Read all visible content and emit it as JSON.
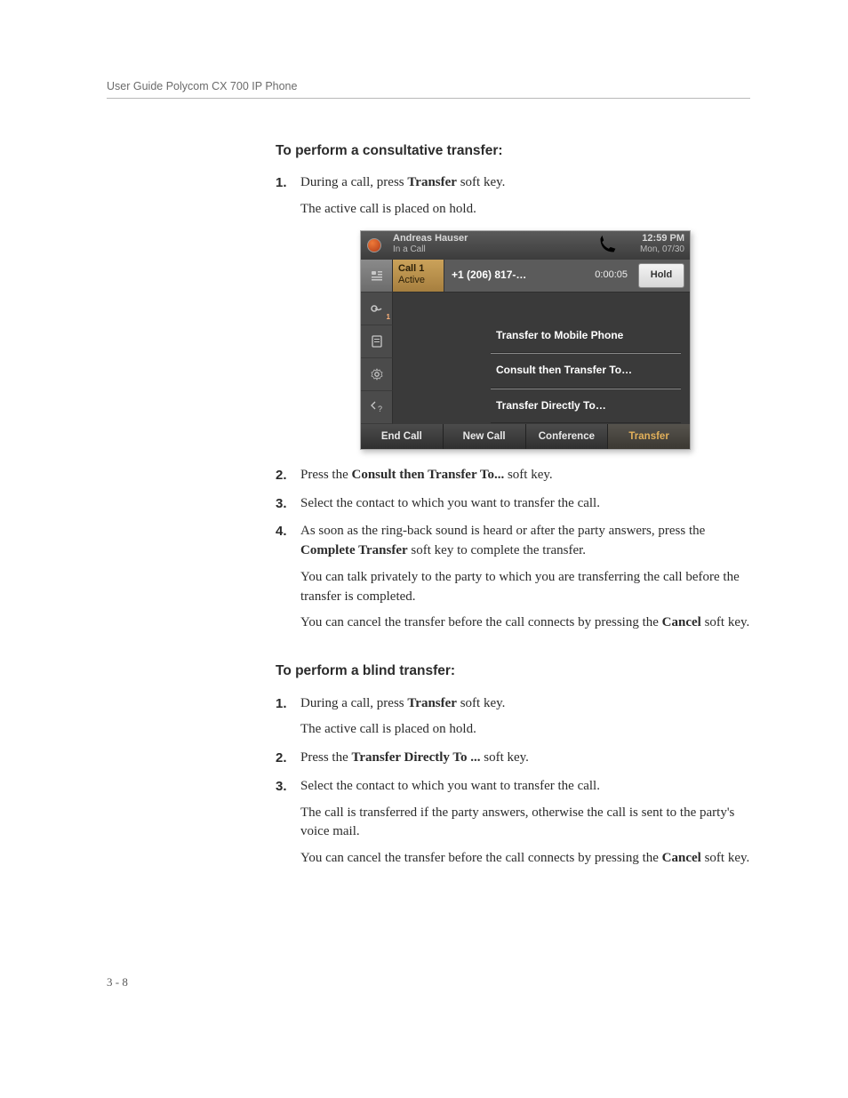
{
  "runhead": "User Guide Polycom CX 700 IP Phone",
  "section1": {
    "heading": "To perform a consultative transfer:",
    "steps": {
      "s1a": "During a call, press ",
      "s1_bold": "Transfer",
      "s1b": " soft key.",
      "s1_p": "The active call is placed on hold.",
      "s2a": "Press the ",
      "s2_bold": "Consult then Transfer To...",
      "s2b": " soft key.",
      "s3": "Select the contact to which you want to transfer the call.",
      "s4a": "As soon as the ring-back sound is heard or after the party answers, press the ",
      "s4_bold": "Complete Transfer",
      "s4b": " soft key to complete the transfer.",
      "s4_p1": "You can talk privately to the party to which you are transferring the call before the transfer is completed.",
      "s4_p2a": "You can cancel the transfer before the call connects by pressing the ",
      "s4_p2_bold": "Cancel",
      "s4_p2b": " soft key."
    }
  },
  "section2": {
    "heading": "To perform a blind transfer:",
    "steps": {
      "s1a": "During a call, press ",
      "s1_bold": "Transfer",
      "s1b": " soft key.",
      "s1_p": "The active call is placed on hold.",
      "s2a": "Press the ",
      "s2_bold": "Transfer Directly To ...",
      "s2b": " soft key.",
      "s3": "Select the contact to which you want to transfer the call.",
      "s3_p1": "The call is transferred if the party answers, otherwise the call is sent to the party's voice mail.",
      "s3_p2a": "You can cancel the transfer before the call connects by pressing the ",
      "s3_p2_bold": "Cancel",
      "s3_p2b": " soft key."
    }
  },
  "phone": {
    "user_name": "Andreas Hauser",
    "user_status": "In a Call",
    "time": "12:59 PM",
    "date": "Mon, 07/30",
    "call_label_line1": "Call 1",
    "call_label_line2": "Active",
    "call_number": "+1 (206) 817-…",
    "call_timer": "0:00:05",
    "hold_label": "Hold",
    "side_badge": "1",
    "menu": {
      "m1": "Transfer to Mobile Phone",
      "m2": "Consult then Transfer To…",
      "m3": "Transfer Directly To…"
    },
    "softkeys": {
      "k1": "End Call",
      "k2": "New Call",
      "k3": "Conference",
      "k4": "Transfer"
    }
  },
  "pagenum": "3 - 8",
  "nums": {
    "n1": "1.",
    "n2": "2.",
    "n3": "3.",
    "n4": "4."
  }
}
